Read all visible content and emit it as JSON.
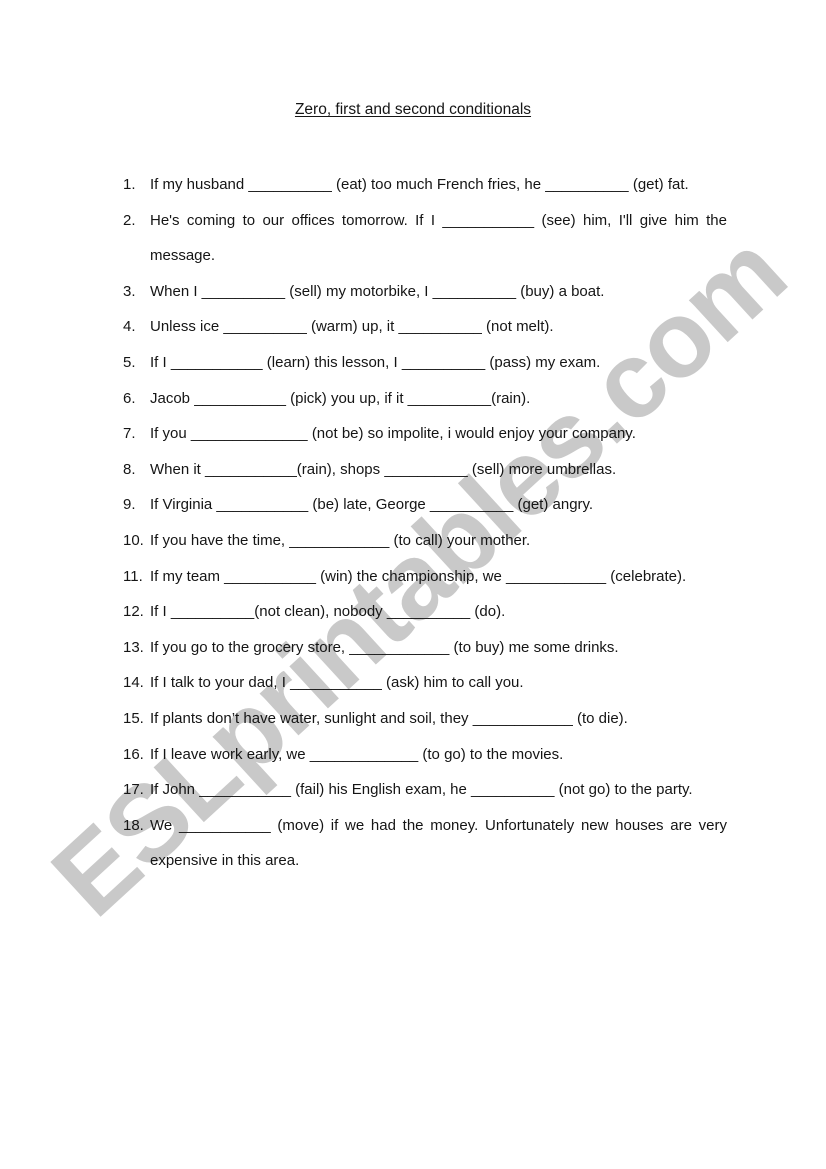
{
  "worksheet": {
    "title": "Zero, first and second conditionals",
    "watermark": "ESLprintables.com",
    "items": [
      {
        "number": "1.",
        "text": "If my husband __________ (eat) too much French fries, he __________ (get) fat.",
        "justify": true
      },
      {
        "number": "2.",
        "text": "He's coming to our offices tomorrow. If I ___________ (see) him, I'll give him the message.",
        "justify": true
      },
      {
        "number": "3.",
        "text": "When I __________ (sell) my motorbike, I __________ (buy) a boat.",
        "justify": false
      },
      {
        "number": "4.",
        "text": "Unless ice __________ (warm) up, it __________ (not melt).",
        "justify": false
      },
      {
        "number": "5.",
        "text": "If I ___________ (learn) this lesson, I __________ (pass) my exam.",
        "justify": false
      },
      {
        "number": "6.",
        "text": "Jacob ___________ (pick) you up, if it __________(rain).",
        "justify": false
      },
      {
        "number": "7.",
        "text": "If you ______________ (not be) so impolite, i would enjoy your company.",
        "justify": true
      },
      {
        "number": "8.",
        "text": "When it ___________(rain), shops __________ (sell) more umbrellas.",
        "justify": false
      },
      {
        "number": "9.",
        "text": "If Virginia ___________ (be) late, George __________ (get) angry.",
        "justify": false
      },
      {
        "number": "10.",
        "text": "If you have the time, ____________ (to call) your mother.",
        "justify": false
      },
      {
        "number": "11.",
        "text": "If my team ___________ (win) the championship, we ____________ (celebrate).",
        "justify": false
      },
      {
        "number": "12.",
        "text": "If I __________(not clean), nobody __________ (do).",
        "justify": false
      },
      {
        "number": "13.",
        "text": "If you go to the grocery store,  ____________ (to buy) me some drinks.",
        "justify": false
      },
      {
        "number": "14.",
        "text": "If I talk to your dad, I ___________ (ask) him to call you.",
        "justify": false
      },
      {
        "number": "15.",
        "text": "If plants don’t have water, sunlight and soil, they ____________ (to die).",
        "justify": true
      },
      {
        "number": "16.",
        "text": "If I leave work early, we _____________ (to go) to the movies.",
        "justify": false
      },
      {
        "number": "17.",
        "text": "If John ___________ (fail) his English exam, he __________ (not go) to the party.",
        "justify": true
      },
      {
        "number": "18.",
        "text": "We ___________ (move) if we had the money. Unfortunately new houses are very expensive in this area.",
        "justify": true
      }
    ]
  }
}
